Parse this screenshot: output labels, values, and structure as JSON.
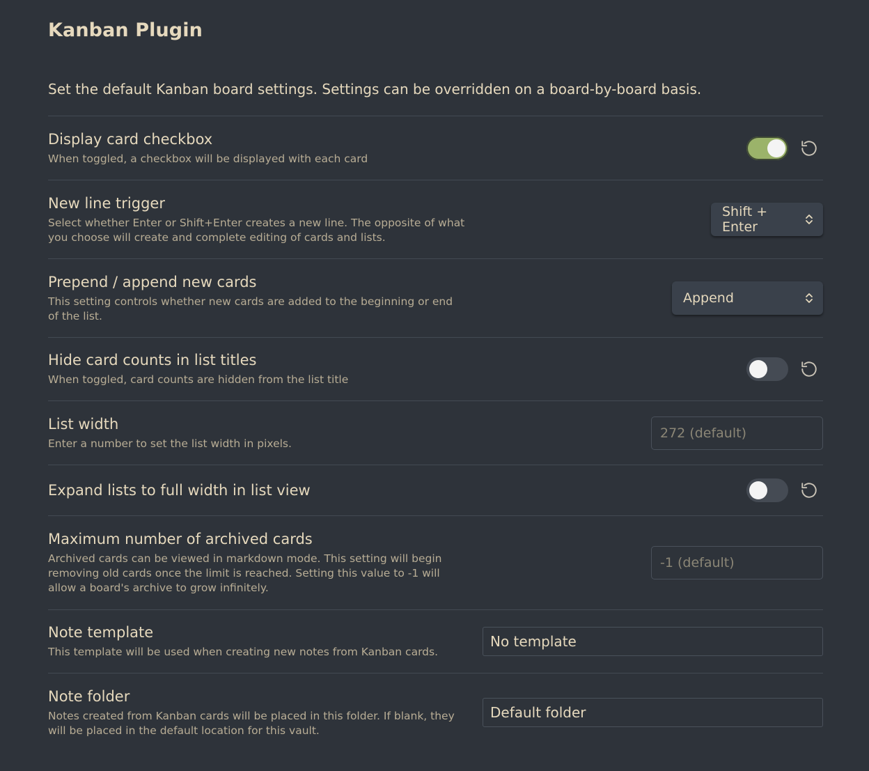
{
  "page": {
    "title": "Kanban Plugin",
    "intro": "Set the default Kanban board settings. Settings can be overridden on a board-by-board basis."
  },
  "settings": [
    {
      "name": "Display card checkbox",
      "description": "When toggled, a checkbox will be displayed with each card",
      "control": "toggle",
      "toggle_on": true
    },
    {
      "name": "New line trigger",
      "description": "Select whether Enter or Shift+Enter creates a new line. The opposite of what you choose will create and complete editing of cards and lists.",
      "control": "dropdown",
      "selected": "Shift + Enter"
    },
    {
      "name": "Prepend / append new cards",
      "description": "This setting controls whether new cards are added to the beginning or end of the list.",
      "control": "dropdown",
      "selected": "Append"
    },
    {
      "name": "Hide card counts in list titles",
      "description": "When toggled, card counts are hidden from the list title",
      "control": "toggle",
      "toggle_on": false
    },
    {
      "name": "List width",
      "description": "Enter a number to set the list width in pixels.",
      "control": "input",
      "placeholder": "272 (default)"
    },
    {
      "name": "Expand lists to full width in list view",
      "description": "",
      "control": "toggle",
      "toggle_on": false
    },
    {
      "name": "Maximum number of archived cards",
      "description": "Archived cards can be viewed in markdown mode. This setting will begin removing old cards once the limit is reached. Setting this value to -1 will allow a board's archive to grow infinitely.",
      "control": "input",
      "placeholder": "-1 (default)"
    },
    {
      "name": "Note template",
      "description": "This template will be used when creating new notes from Kanban cards.",
      "control": "search",
      "value": "No template"
    },
    {
      "name": "Note folder",
      "description": "Notes created from Kanban cards will be placed in this folder. If blank, they will be placed in the default location for this vault.",
      "control": "search",
      "value": "Default folder"
    }
  ],
  "colors": {
    "background": "#2e333a",
    "text": "#e6d9bd",
    "muted_text": "#b8ad95",
    "toggle_on": "#9bb36a",
    "toggle_off": "#454b54",
    "divider": "#434a53"
  },
  "icons": {
    "reset": "reset-icon",
    "dropdown": "chevron-updown-icon"
  }
}
